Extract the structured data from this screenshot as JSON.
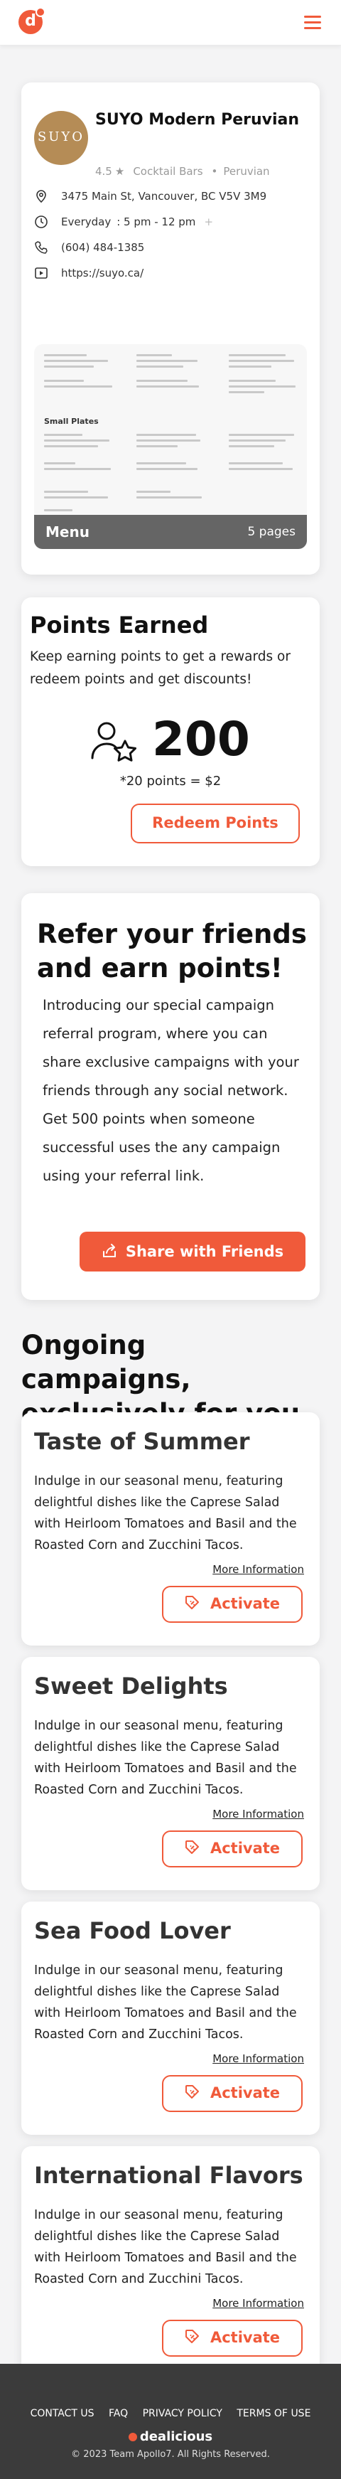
{
  "header": {
    "logo_letter": "d",
    "icons": {
      "menu": "hamburger-menu-icon",
      "accent": "#f05a3a"
    }
  },
  "restaurant": {
    "avatar_text": "SUYO",
    "name": "SUYO Modern Peruvian",
    "rating": "4.5",
    "category": "Cocktail Bars",
    "cuisine": "Peruvian",
    "address": "3475 Main St, Vancouver, BC V5V 3M9",
    "hours_label": "Everyday",
    "hours": ": 5 pm - 12 pm",
    "phone": "(604) 484-1385",
    "website": "https://suyo.ca/",
    "menu": {
      "label": "Menu",
      "pages": "5 pages",
      "section": "Small Plates"
    }
  },
  "points": {
    "title": "Points Earned",
    "description": "Keep earning points to get a rewards or redeem points and get discounts!",
    "value": "200",
    "rate": "*20 points = $2",
    "redeem_label": "Redeem Points"
  },
  "refer": {
    "title": "Refer your friends and earn points!",
    "description": "Introducing our special campaign referral program, where you can share exclusive campaigns with your friends through any social network. Get 500 points when someone successful uses the any campaign using your referral link.",
    "share_label": "Share with Friends"
  },
  "campaigns": {
    "section_title": "Ongoing campaigns, exclusively for you",
    "items": [
      {
        "title": "Taste of Summer",
        "description": "Indulge in our seasonal menu, featuring delightful dishes like the Caprese Salad with Heirloom Tomatoes and Basil and the Roasted Corn and Zucchini Tacos.",
        "more": "More Information",
        "action": "Activate"
      },
      {
        "title": "Sweet Delights",
        "description": "Indulge in our seasonal menu, featuring delightful dishes like the Caprese Salad with Heirloom Tomatoes and Basil and the Roasted Corn and Zucchini Tacos.",
        "more": "More Information",
        "action": "Activate"
      },
      {
        "title": "Sea Food Lover",
        "description": "Indulge in our seasonal menu, featuring delightful dishes like the Caprese Salad with Heirloom Tomatoes and Basil and the Roasted Corn and Zucchini Tacos.",
        "more": "More Information",
        "action": "Activate"
      },
      {
        "title": "International Flavors",
        "description": "Indulge in our seasonal menu, featuring delightful dishes like the Caprese Salad with Heirloom Tomatoes and Basil and the Roasted Corn and Zucchini Tacos.",
        "more": "More Information",
        "action": "Activate"
      }
    ]
  },
  "footer": {
    "links": [
      "CONTACT US",
      "FAQ",
      "PRIVACY POLICY",
      "TERMS OF USE"
    ],
    "brand": "dealicious",
    "copyright": "© 2023 Team Apollo7. All Rights Reserved."
  }
}
